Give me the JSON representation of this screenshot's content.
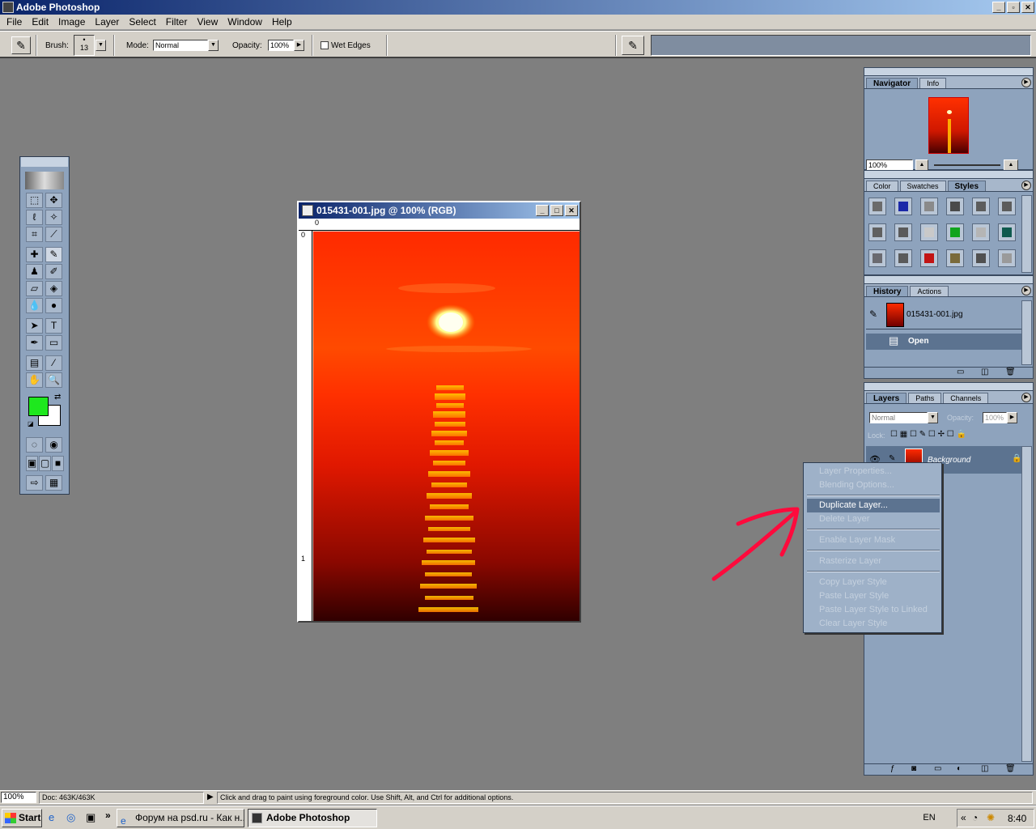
{
  "app": {
    "title": "Adobe Photoshop"
  },
  "menu": [
    "File",
    "Edit",
    "Image",
    "Layer",
    "Select",
    "Filter",
    "View",
    "Window",
    "Help"
  ],
  "options": {
    "brush_label": "Brush:",
    "brush_size": "13",
    "mode_label": "Mode:",
    "mode_value": "Normal",
    "opacity_label": "Opacity:",
    "opacity_value": "100%",
    "wet_edges": "Wet Edges"
  },
  "document": {
    "title": "015431-001.jpg @ 100% (RGB)",
    "ruler_h": "0",
    "ruler_v_top": "0",
    "ruler_v_mid": "1"
  },
  "navigator": {
    "tabs": [
      "Navigator",
      "Info"
    ],
    "zoom": "100%"
  },
  "styles_panel": {
    "tabs": [
      "Color",
      "Swatches",
      "Styles"
    ],
    "swatches": [
      "#6b6b6b",
      "#1a28a8",
      "#8a8a8a",
      "#4a4a4a",
      "#5c5c5c",
      "#5c5c5c",
      "#606060",
      "#5a5a5a",
      "#c9c9c9",
      "#11a41e",
      "#b5b5b5",
      "#0f5a4e",
      "#6a6a70",
      "#5a5a5a",
      "#c21414",
      "#7a6a3a",
      "#505050",
      "#9a9a9a"
    ]
  },
  "history": {
    "tabs": [
      "History",
      "Actions"
    ],
    "snapshot": "015431-001.jpg",
    "step": "Open"
  },
  "layers": {
    "tabs": [
      "Layers",
      "Paths",
      "Channels"
    ],
    "blend": "Normal",
    "opacity_label": "Opacity:",
    "opacity_value": "100%",
    "lock_label": "Lock:",
    "layer_name": "Background"
  },
  "context_menu": [
    {
      "label": "Layer Properties...",
      "enabled": false
    },
    {
      "label": "Blending Options...",
      "enabled": false
    },
    {
      "label": "Duplicate Layer...",
      "enabled": true,
      "highlighted": true
    },
    {
      "label": "Delete Layer",
      "enabled": false
    },
    {
      "label": "Enable Layer Mask",
      "enabled": false
    },
    {
      "label": "Rasterize Layer",
      "enabled": false
    },
    {
      "label": "Copy Layer Style",
      "enabled": false
    },
    {
      "label": "Paste Layer Style",
      "enabled": false
    },
    {
      "label": "Paste Layer Style to Linked",
      "enabled": false
    },
    {
      "label": "Clear Layer Style",
      "enabled": false
    }
  ],
  "status": {
    "zoom": "100%",
    "doc": "Doc: 463K/463K",
    "hint": "Click and drag to paint using foreground color.  Use Shift, Alt, and Ctrl for additional options."
  },
  "taskbar": {
    "start": "Start",
    "tasks": [
      "Форум на psd.ru - Как н...",
      "Adobe Photoshop"
    ],
    "lang": "EN",
    "clock": "8:40"
  },
  "colors": {
    "foreground": "#1ee81e",
    "background": "#ffffff",
    "highlight": "#5c7390",
    "arrow": "#ff0a3c"
  }
}
